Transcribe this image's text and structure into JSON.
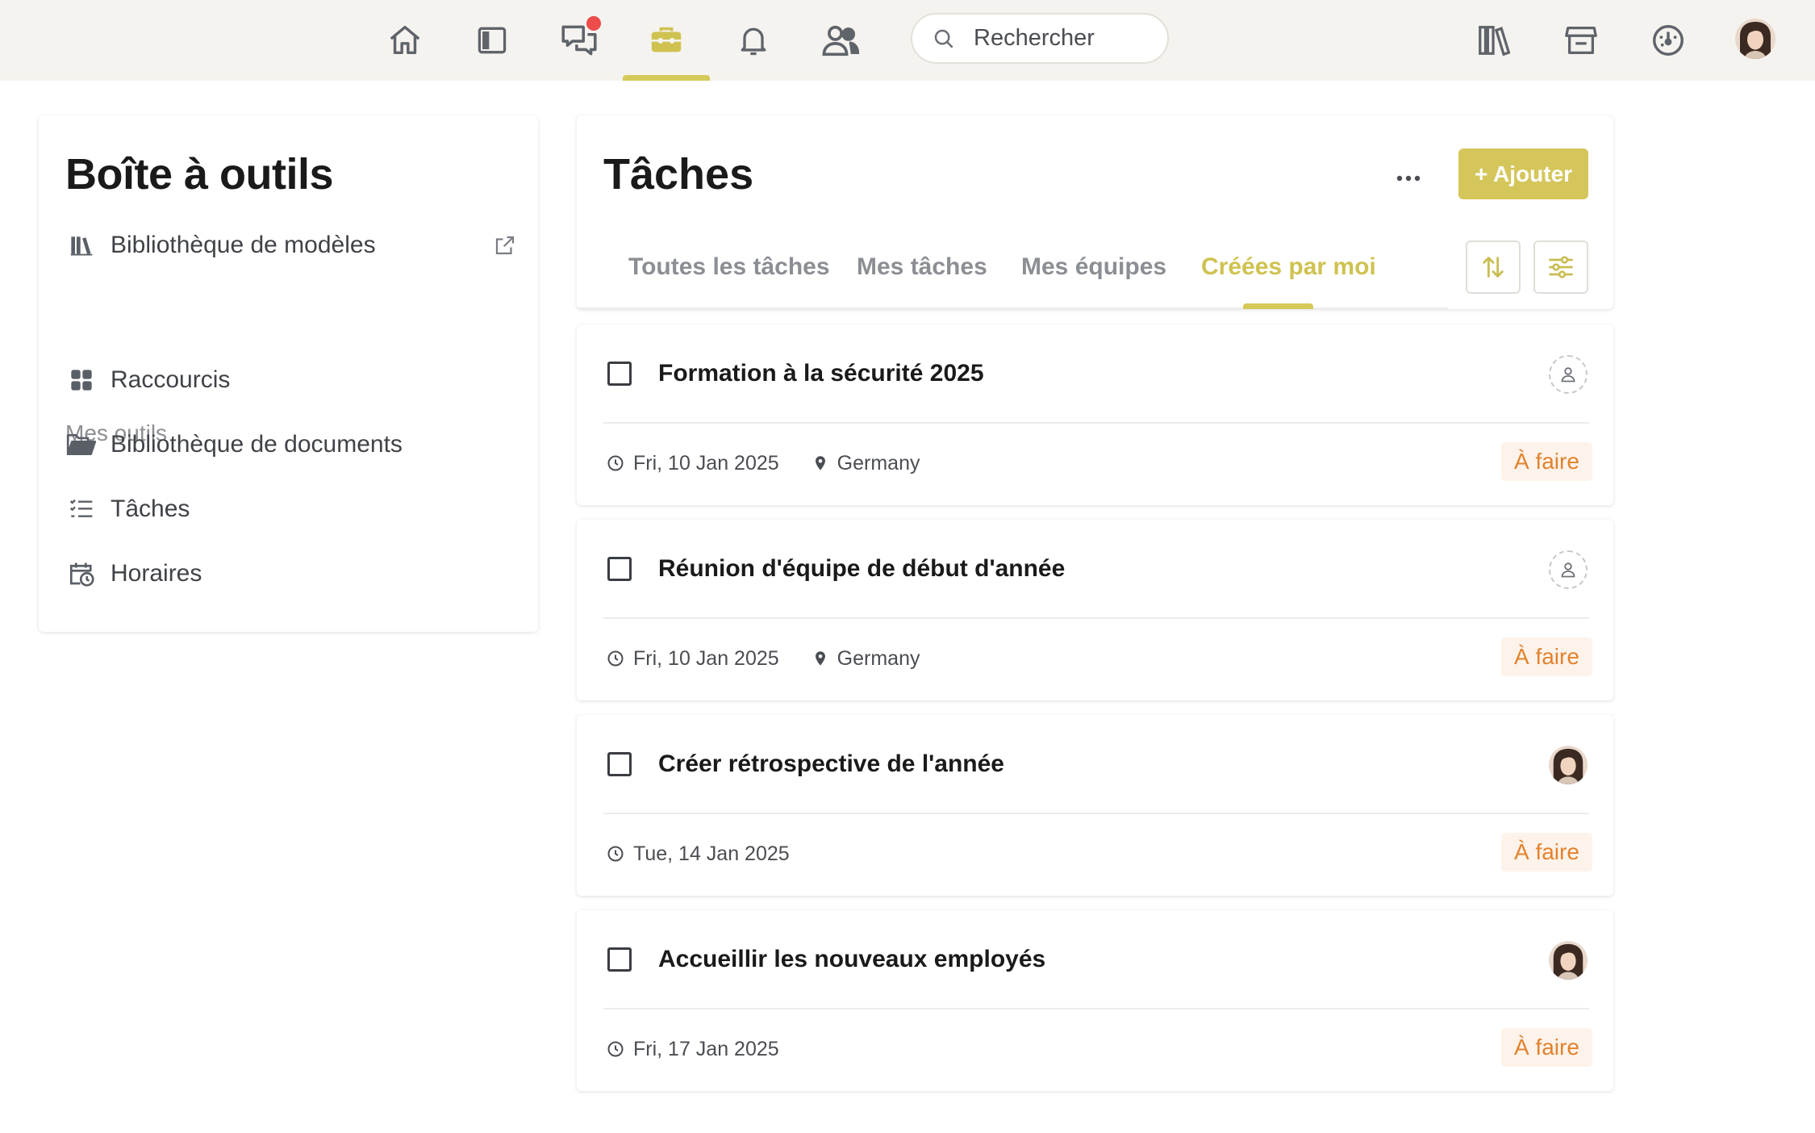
{
  "nav": {
    "icons": [
      "home-icon",
      "sidebar-panel-icon",
      "chat-icon",
      "briefcase-icon",
      "bell-icon",
      "users-icon",
      "library-icon",
      "store-icon",
      "dashboard-icon"
    ],
    "active": "briefcase-icon",
    "chat_has_notification": true,
    "search_placeholder": "Rechercher",
    "accent_color": "#d5c95a",
    "notification_color": "#ee4b4b"
  },
  "sidebar": {
    "title": "Boîte à outils",
    "library_link": "Bibliothèque de modèles",
    "section_label": "Mes outils",
    "items": [
      {
        "label": "Raccourcis",
        "icon": "grid-icon"
      },
      {
        "label": "Bibliothèque de documents",
        "icon": "folder-icon"
      },
      {
        "label": "Tâches",
        "icon": "checklist-icon"
      },
      {
        "label": "Horaires",
        "icon": "calendar-clock-icon"
      }
    ]
  },
  "tasks": {
    "title": "Tâches",
    "add_label": "+ Ajouter",
    "tabs": [
      "Toutes les tâches",
      "Mes tâches",
      "Mes équipes",
      "Créées par moi"
    ],
    "active_tab": "Créées par moi",
    "items": [
      {
        "title": "Formation à la sécurité 2025",
        "date": "Fri, 10 Jan 2025",
        "location": "Germany",
        "status": "À faire",
        "assignee": "unassigned"
      },
      {
        "title": "Réunion d'équipe de début d'année",
        "date": "Fri, 10 Jan 2025",
        "location": "Germany",
        "status": "À faire",
        "assignee": "unassigned"
      },
      {
        "title": "Créer rétrospective de l'année",
        "date": "Tue, 14 Jan 2025",
        "location": "",
        "status": "À faire",
        "assignee": "avatar"
      },
      {
        "title": "Accueillir les nouveaux employés",
        "date": "Fri, 17 Jan 2025",
        "location": "",
        "status": "À faire",
        "assignee": "avatar"
      }
    ],
    "status_color": "#e3822d",
    "status_bg": "#fdf3ea"
  }
}
